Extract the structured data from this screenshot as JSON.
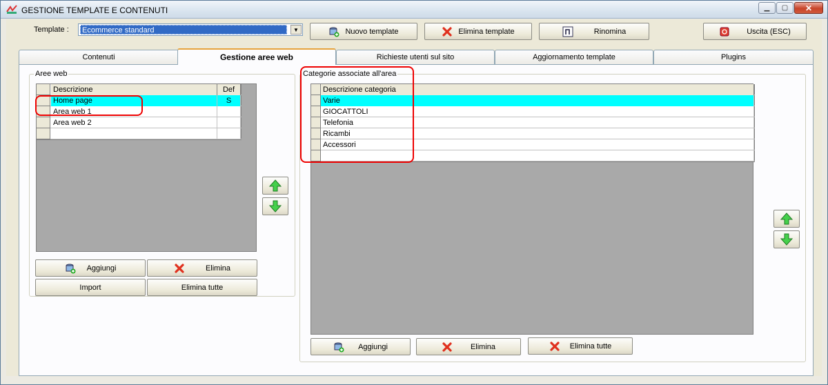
{
  "window": {
    "title": "GESTIONE TEMPLATE E CONTENUTI"
  },
  "toolbar": {
    "template_label": "Template :",
    "template_value": "Ecommerce standard",
    "new_template": "Nuovo template",
    "delete_template": "Elimina template",
    "rename": "Rinomina",
    "exit": "Uscita (ESC)"
  },
  "tabs": [
    {
      "label": "Contenuti"
    },
    {
      "label": "Gestione aree web",
      "active": true
    },
    {
      "label": "Richieste utenti sul sito"
    },
    {
      "label": "Aggiornamento template"
    },
    {
      "label": "Plugins"
    }
  ],
  "aree_web": {
    "title": "Aree web",
    "headers": {
      "descrizione": "Descrizione",
      "def": "Def"
    },
    "rows": [
      {
        "descrizione": "Home page",
        "def": "S"
      },
      {
        "descrizione": "Area web 1",
        "def": ""
      },
      {
        "descrizione": "Area web 2",
        "def": ""
      }
    ],
    "add": "Aggiungi",
    "delete": "Elimina",
    "import": "Import",
    "delete_all": "Elimina tutte"
  },
  "categorie": {
    "title": "Categorie associate all'area",
    "header": "Descrizione categoria",
    "rows": [
      "Varie",
      "GIOCATTOLI",
      "Telefonia",
      "Ricambi",
      "Accessori"
    ],
    "add": "Aggiungi",
    "delete": "Elimina",
    "delete_all": "Elimina tutte"
  },
  "colors": {
    "selection": "#00ffff",
    "highlight": "#e00000"
  }
}
